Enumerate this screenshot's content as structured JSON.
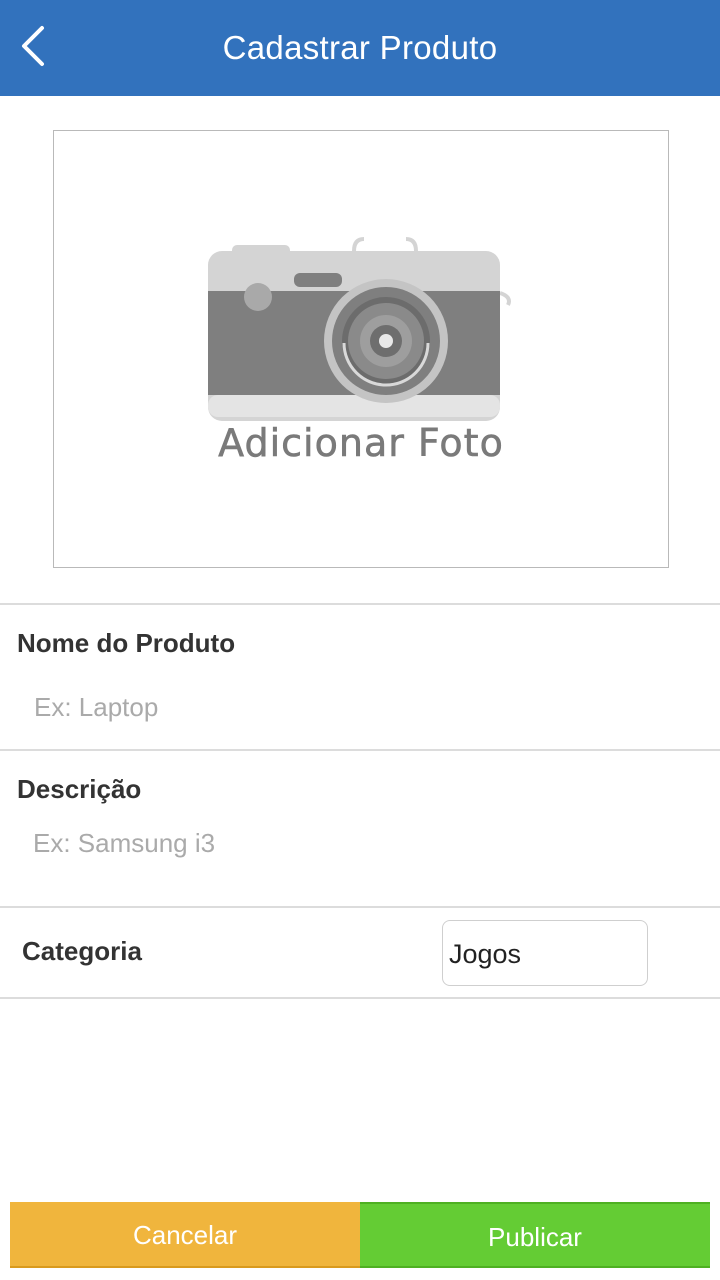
{
  "header": {
    "title": "Cadastrar Produto",
    "back_icon": "chevron-left-icon",
    "background_color": "#3272bd"
  },
  "photo": {
    "label": "Adicionar Foto",
    "icon": "camera-icon"
  },
  "form": {
    "product_name": {
      "label": "Nome do Produto",
      "value": "",
      "placeholder": "Ex: Laptop"
    },
    "description": {
      "label": "Descrição",
      "value": "",
      "placeholder": "Ex: Samsung i3"
    },
    "category": {
      "label": "Categoria",
      "selected": "Jogos"
    }
  },
  "actions": {
    "cancel_label": "Cancelar",
    "cancel_color": "#f0b53d",
    "publish_label": "Publicar",
    "publish_color": "#64cc34"
  }
}
